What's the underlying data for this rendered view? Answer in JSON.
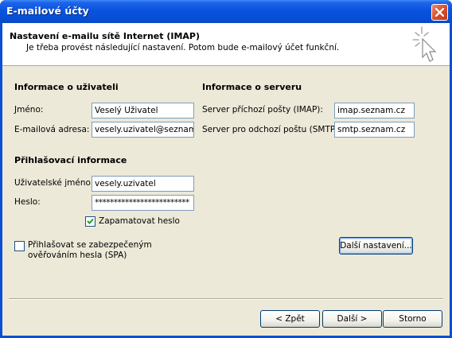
{
  "window": {
    "title": "E-mailové účty"
  },
  "header": {
    "title": "Nastavení e-mailu sítě Internet (IMAP)",
    "subtitle": "Je třeba provést následující nastavení. Potom bude e-mailový účet funkční."
  },
  "user_info": {
    "heading": "Informace o uživateli",
    "name_label": "Jméno:",
    "name_value": "Veselý Uživatel",
    "email_label": "E-mailová adresa:",
    "email_value": "vesely.uzivatel@seznam.cz"
  },
  "server_info": {
    "heading": "Informace o serveru",
    "incoming_label": "Server příchozí pošty (IMAP):",
    "incoming_value": "imap.seznam.cz",
    "outgoing_label": "Server pro odchozí poštu (SMTP):",
    "outgoing_value": "smtp.seznam.cz"
  },
  "login_info": {
    "heading": "Přihlašovací informace",
    "username_label": "Uživatelské jméno:",
    "username_value": "vesely.uzivatel",
    "password_label": "Heslo:",
    "password_value": "*************************",
    "remember_label": "Zapamatovat heslo",
    "remember_checked": true,
    "spa_label_line1": "Přihlašovat se zabezpečeným",
    "spa_label_line2": "ověřováním hesla (SPA)",
    "spa_checked": false
  },
  "buttons": {
    "more_settings": "Další nastavení...",
    "back": "< Zpět",
    "next": "Další >",
    "cancel": "Storno"
  },
  "colors": {
    "titlebar": "#0a53df",
    "dialog_bg": "#ece9d8",
    "field_border": "#7f9db9"
  }
}
